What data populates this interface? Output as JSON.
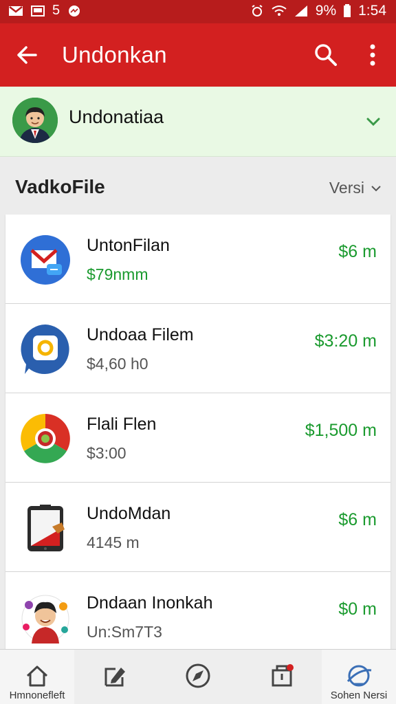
{
  "status_bar": {
    "notification_count": "5",
    "battery": "9%",
    "time": "1:54",
    "icons": [
      "gmail-icon",
      "screen-icon",
      "messenger-icon",
      "alarm-icon",
      "wifi-icon",
      "signal-icon",
      "battery-icon"
    ]
  },
  "app_bar": {
    "title": "Undonkan",
    "icons": [
      "back-arrow-icon",
      "search-icon",
      "more-vert-icon"
    ]
  },
  "account": {
    "name": "Undonatiaa",
    "icon": "chevron-down-icon"
  },
  "section": {
    "heading": "VadkoFile",
    "sort_label": "Versi"
  },
  "items": [
    {
      "title": "UntonFilan",
      "subtitle": "$79nmm",
      "price": "$6 m",
      "icon": "mail-app-icon"
    },
    {
      "title": "Undoaa Filem",
      "subtitle": "$4,60 h0",
      "price": "$3:20 m",
      "icon": "camera-app-icon"
    },
    {
      "title": "Flali Flen",
      "subtitle": "$3:00",
      "price": "$1,500 m",
      "icon": "chrome-icon"
    },
    {
      "title": "UndoMdan",
      "subtitle": "4145 m",
      "price": "$6 m",
      "icon": "tablet-app-icon"
    },
    {
      "title": "Dndaan Inonkah",
      "subtitle": "Un:Sm7T3",
      "price": "$0 m",
      "icon": "avatar-app-icon"
    }
  ],
  "bottom_nav": [
    {
      "label": "Hmnonefleft",
      "icon": "home-icon"
    },
    {
      "label": "",
      "icon": "edit-icon"
    },
    {
      "label": "",
      "icon": "compass-icon"
    },
    {
      "label": "",
      "icon": "inbox-icon"
    },
    {
      "label": "Sohen Nersi",
      "icon": "globe-icon"
    }
  ],
  "colors": {
    "status_bar": "#b71c1c",
    "app_bar": "#d32020",
    "account_bg": "#e9f9e4",
    "price_green": "#1a9a2e"
  }
}
